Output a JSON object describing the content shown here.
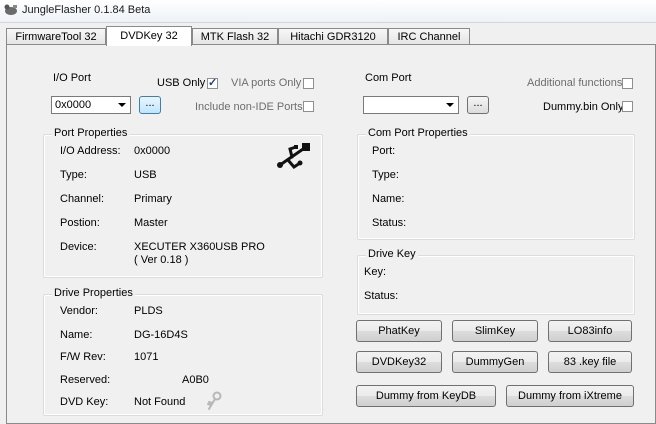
{
  "window": {
    "title": "JungleFlasher 0.1.84 Beta",
    "icon": "jungle-flasher-app-icon"
  },
  "tabs": [
    {
      "label": "FirmwareTool 32"
    },
    {
      "label": "DVDKey 32"
    },
    {
      "label": "MTK Flash 32"
    },
    {
      "label": "Hitachi GDR3120"
    },
    {
      "label": "IRC Channel"
    }
  ],
  "io_port": {
    "label": "I/O Port",
    "selected": "0x0000",
    "browse_label": "...",
    "usb_only_label": "USB Only",
    "via_ports_label": "VIA ports Only",
    "non_ide_label": "Include non-IDE Ports"
  },
  "com_port": {
    "label": "Com Port",
    "selected": "",
    "browse_label": "...",
    "additional_label": "Additional functions",
    "dummy_only_label": "Dummy.bin Only"
  },
  "port_properties": {
    "legend": "Port Properties",
    "address_label": "I/O Address:",
    "address": "0x0000",
    "type_label": "Type:",
    "type": "USB",
    "channel_label": "Channel:",
    "channel": "Primary",
    "position_label": "Postion:",
    "position": "Master",
    "device_label": "Device:",
    "device_line1": "XECUTER X360USB PRO",
    "device_line2": "( Ver 0.18 )"
  },
  "com_port_properties": {
    "legend": "Com Port Properties",
    "port_label": "Port:",
    "type_label": "Type:",
    "name_label": "Name:",
    "status_label": "Status:"
  },
  "drive_properties": {
    "legend": "Drive Properties",
    "vendor_label": "Vendor:",
    "vendor": "PLDS",
    "name_label": "Name:",
    "name": "DG-16D4S",
    "fw_label": "F/W Rev:",
    "fw": "1071",
    "reserved_label": "Reserved:",
    "reserved": "A0B0",
    "dvdkey_label": "DVD Key:",
    "dvdkey": "Not Found"
  },
  "drive_key": {
    "legend": "Drive Key",
    "key_label": "Key:",
    "status_label": "Status:"
  },
  "buttons": {
    "phatkey": "PhatKey",
    "slimkey": "SlimKey",
    "lo83info": "LO83info",
    "dvdkey32": "DVDKey32",
    "dummygen": "DummyGen",
    "key83file": "83 .key file",
    "dummy_keydb": "Dummy from KeyDB",
    "dummy_ixtreme": "Dummy from iXtreme"
  }
}
